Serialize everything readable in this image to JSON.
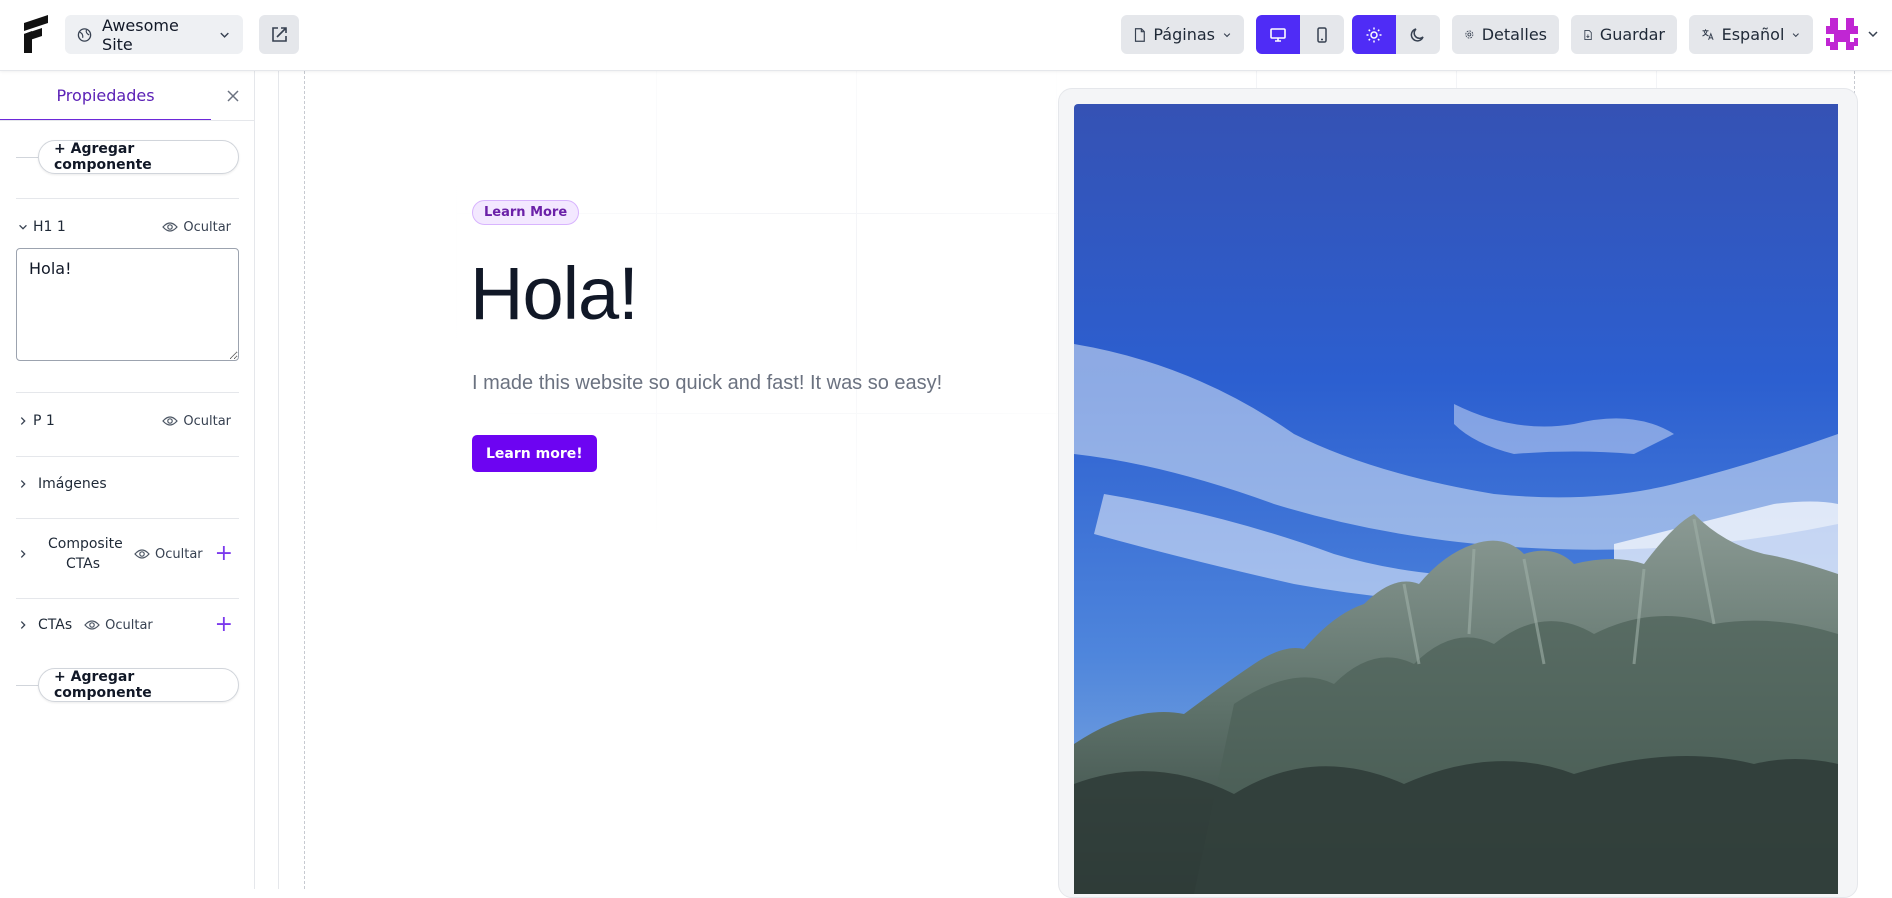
{
  "topbar": {
    "site_name": "Awesome Site",
    "pages_label": "Páginas",
    "details_label": "Detalles",
    "save_label": "Guardar",
    "language_label": "Español",
    "accent_color": "#4f2cf6"
  },
  "sidebar": {
    "tab_label": "Propiedades",
    "add_component_label": "+ Agregar componente",
    "hide_label": "Ocultar",
    "components": [
      {
        "label": "H1 1"
      },
      {
        "label": "P 1"
      },
      {
        "label": "Imágenes"
      },
      {
        "label": "Composite CTAs"
      },
      {
        "label": "CTAs"
      }
    ],
    "h1_value": "Hola!"
  },
  "preview": {
    "badge": "Learn More",
    "heading": "Hola!",
    "paragraph": "I made this website so quick and fast! It was so easy!",
    "cta": "Learn more!",
    "cta_color": "#6d04f2"
  }
}
